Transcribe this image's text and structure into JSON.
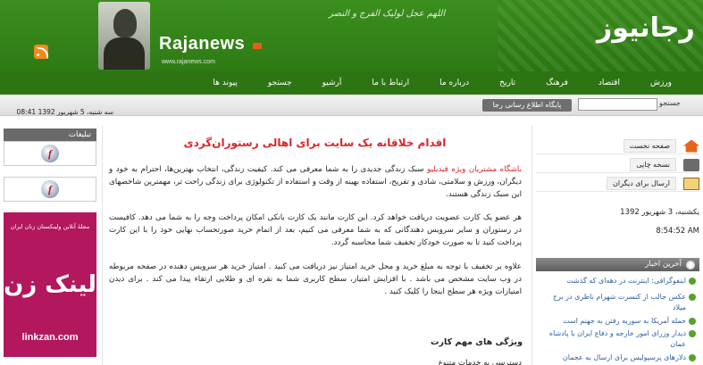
{
  "header": {
    "logo_fa": "رجانیوز",
    "logo_en": "Rajanews",
    "logo_url": "www.rajanews.com",
    "calligraphy": "اللهم عجل لولیک الفرج و النصر"
  },
  "nav": [
    "ورزش",
    "اقتصاد",
    "فرهنگ",
    "تاریخ",
    "درباره ما",
    "ارتباط با ما",
    "آرشیو",
    "جستجو",
    "پیوند ها"
  ],
  "subbar": {
    "date": "سه شنبه، 5 شهریور 1392  08:41",
    "search_label": "جستجو",
    "site_title": "پایگاه اطلاع رسانی رجا"
  },
  "ads": {
    "title": "تبلیغات",
    "flash_icon": "f",
    "linkzan_top": "مجلۀ آنلاین ولینکستان زنان ایران",
    "linkzan_main": "لینک زن",
    "linkzan_url": "linkzan.com"
  },
  "article": {
    "title": "اقدام خلاقانه یک سایت برای اهالی رستوران‌گردی",
    "para1_link": "باشگاه مشتریان ویژه فیدیلیو",
    "para1": " سبک زندگی جدیدی را به شما معرفی می کند. کیفیت زندگی، انتخاب بهترین‌ها، احترام به خود و دیگران، ورزش و سلامتی، شادی و تفریح، استفاده بهینه از وقت و استفاده از تکنولوژی برای زندگی راحت تر، مهمترین شاخصهای این سبک زندگی هستند.",
    "para2": "هر عضو یک کارت عضویت دریافت خواهد کرد. این کارت مانند یک کارت بانکی امکان پرداخت وجه را به شما می دهد. کافیست در رستوران و سایر سرویس دهندگانی که به شما معرفی می کنیم، بعد از اتمام خرید صورتحساب نهایی خود را با این کارت پرداخت کنید تا به صورت خودکار تخفیف شما محاسبه گردد.",
    "para3": "علاوه بر تخفیف با توجه به مبلغ خرید و محل خرید امتیاز نیز دریافت می کنید . امتیاز خرید هر سرویس دهنده در صفحه مربوطه در وب سایت مشخص می باشد . با افزایش امتیاز، سطح کاربری شما به نقره ای و طلایی ارتقاء پیدا می کند . برای دیدن امتیازات ویژه هر سطح اینجا را کلیک کنید .",
    "subheading": "ویژگی های مهم کارت",
    "para4": "دسترسی به خدمات متنوع"
  },
  "tools": {
    "home": "صفحه نخست",
    "print": "نسخه چاپی",
    "send": "ارسال برای دیگران"
  },
  "sidebar": {
    "date": "یکشنبه، 3 شهریور 1392",
    "time": "8:54:52 AM",
    "latest_title": "آخرین اخبار",
    "news": [
      "اینفوگرافی: اینترنت در دهه‌ای که گذشت",
      "عکس جالب از کنسرت شهرام ناظری در برج میلاد",
      "حمله آمریکا به سوریه رفتن به جهنم است",
      "دیدار وزرای امور خارجه و دفاع ایران با پادشاه عمان",
      "دلارهای پرسپولیس برای ارسال به عجمان"
    ]
  },
  "colors": {
    "brand_green": "#2e7a14",
    "accent_red": "#d9252a",
    "link_blue": "#2d5fa3"
  }
}
